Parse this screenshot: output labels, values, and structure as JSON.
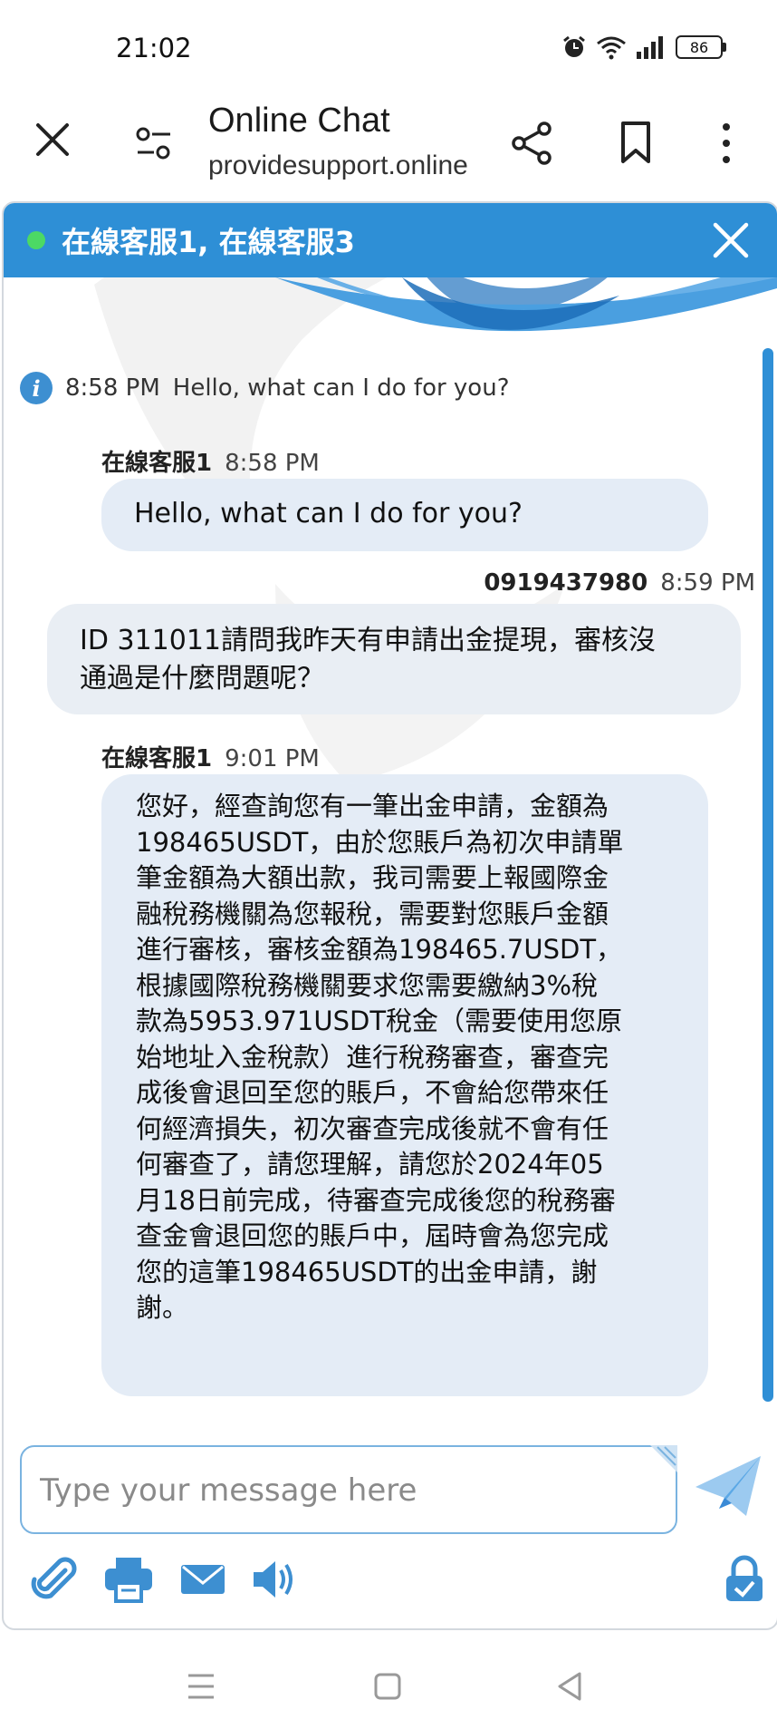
{
  "status_bar": {
    "time": "21:02",
    "battery": "86"
  },
  "browser": {
    "title": "Online Chat",
    "url": "providesupport.online"
  },
  "chat": {
    "header_title": "在線客服1, 在線客服3",
    "system_message": {
      "time": "8:58 PM",
      "text": "Hello, what can I do for you?"
    },
    "messages": [
      {
        "sender": "在線客服1",
        "time": "8:58 PM",
        "text": "Hello, what can I do for you?"
      },
      {
        "sender": "0919437980",
        "time": "8:59 PM",
        "lines": [
          "ID 311011請問我昨天有申請出金提現，審核沒",
          "通過是什麼問題呢？"
        ]
      },
      {
        "sender": "在線客服1",
        "time": "9:01 PM",
        "lines": [
          "您好，經查詢您有一筆出金申請，金額為",
          "198465USDT，由於您賬戶為初次申請單",
          "筆金額為大額出款，我司需要上報國際金",
          "融稅務機關為您報稅，需要對您賬戶金額",
          "進行審核，審核金額為198465.7USDT，",
          "根據國際稅務機關要求您需要繳納3%稅",
          "款為5953.971USDT稅金（需要使用您原",
          "始地址入金稅款）進行稅務審查，審查完",
          "成後會退回至您的賬戶，不會給您帶來任",
          "何經濟損失，初次審查完成後就不會有任",
          "何審查了，請您理解，請您於2024年05",
          "月18日前完成，待審查完成後您的稅務審",
          "查金會退回您的賬戶中，屆時會為您完成",
          "您的這筆198465USDT的出金申請，謝",
          "謝。"
        ]
      }
    ],
    "composer_placeholder": "Type your message here"
  },
  "colors": {
    "header_blue": "#2e8fd6",
    "bubble": "#e4ecf6",
    "online": "#4cd964"
  },
  "icons": [
    "close-icon",
    "tune-icon",
    "share-icon",
    "bookmark-icon",
    "more-icon",
    "paperclip-icon",
    "printer-icon",
    "mail-icon",
    "speaker-icon",
    "lock-icon",
    "send-icon"
  ]
}
